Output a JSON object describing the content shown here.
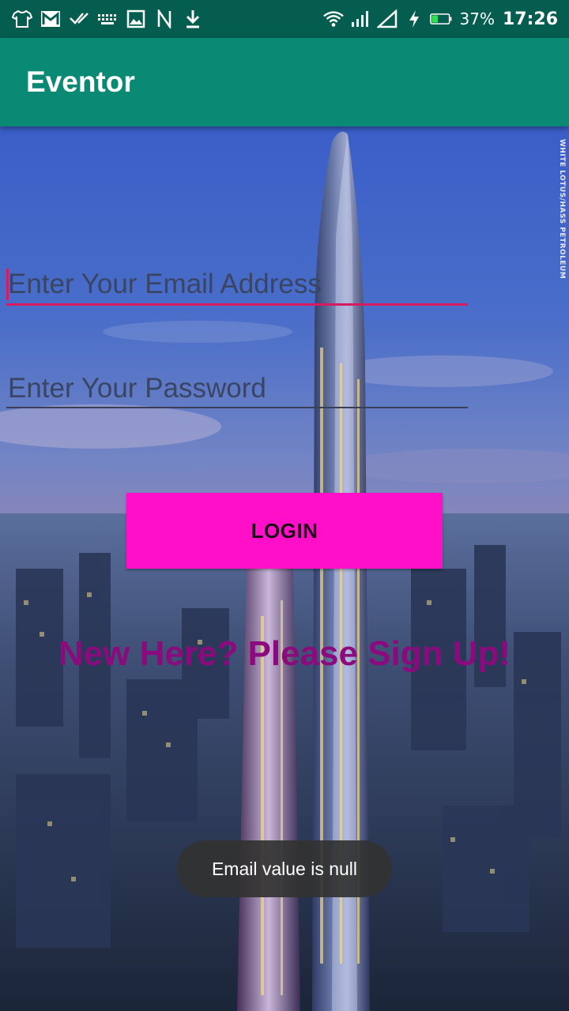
{
  "status_bar": {
    "left_icons": [
      "tshirt-icon",
      "gmail-icon",
      "check-icon",
      "keyboard-icon",
      "image-icon",
      "n-icon",
      "download-icon"
    ],
    "right_icons": [
      "wifi-icon",
      "cell-signal-icon",
      "no-signal-icon",
      "flash-icon",
      "battery-icon"
    ],
    "battery_percent": "37%",
    "battery_fill_fraction": 0.37,
    "battery_color": "#2ee04a",
    "time": "17:26",
    "background": "#045d4e"
  },
  "app_bar": {
    "title": "Eventor",
    "color": "#0a8a74"
  },
  "form": {
    "email_placeholder": "Enter Your Email Address",
    "password_placeholder": "Enter Your Password",
    "accent_color": "#d81b60",
    "login_label": "LOGIN",
    "login_color": "#ff10c8",
    "signup_text": "New Here? Please Sign Up!",
    "signup_color": "#8b0a7e"
  },
  "toast": {
    "message": "Email value is null"
  },
  "watermark": {
    "text": "WHITE LOTUS/HASS PETROLEUM"
  }
}
